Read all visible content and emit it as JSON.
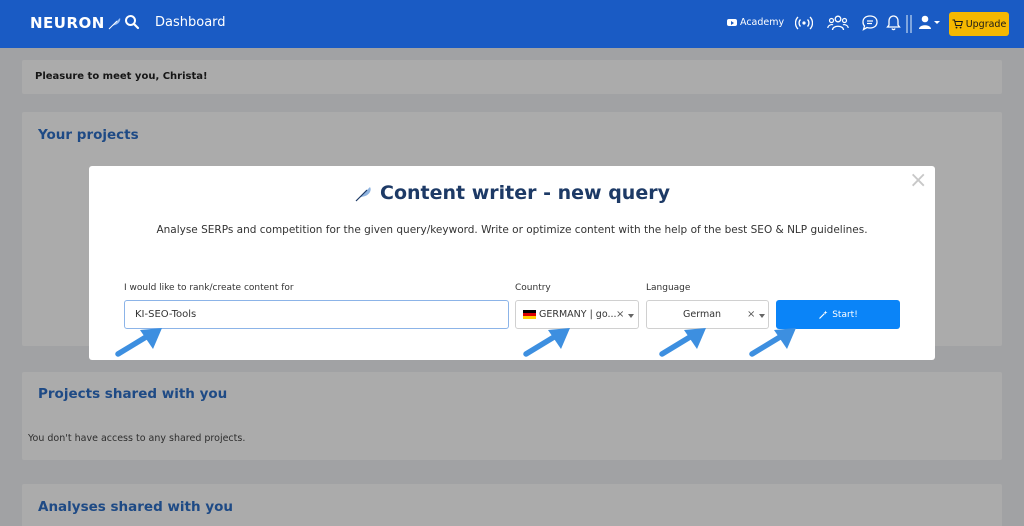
{
  "navbar": {
    "logo": "NEURON",
    "title": "Dashboard",
    "academy_label": "Academy",
    "upgrade_label": "Upgrade",
    "icons": [
      "search-icon",
      "youtube-icon",
      "broadcast-icon",
      "users-icon",
      "chat-icon",
      "bell-icon",
      "user-icon",
      "cart-icon"
    ]
  },
  "page": {
    "greeting": "Pleasure to meet you, Christa!",
    "projects_title": "Your projects",
    "shared_title": "Projects shared with you",
    "shared_empty": "You don't have access to any shared projects.",
    "analyses_title": "Analyses shared with you"
  },
  "modal": {
    "title": "Content writer - new query",
    "description": "Analyse SERPs and competition for the given query/keyword. Write or optimize content with the help of the best SEO & NLP guidelines.",
    "query_label": "I would like to rank/create content for",
    "query_value": "KI-SEO-Tools",
    "country_label": "Country",
    "country_value": "GERMANY | go...",
    "language_label": "Language",
    "language_value": "German",
    "start_label": "Start!",
    "close_symbol": "×",
    "clear_symbol": "×"
  },
  "colors": {
    "navbar": "#1a5bc4",
    "upgrade": "#f5b800",
    "start_button": "#0a84f8",
    "heading_blue": "#2d6fc7",
    "arrow_blue": "#3d8fe0"
  }
}
